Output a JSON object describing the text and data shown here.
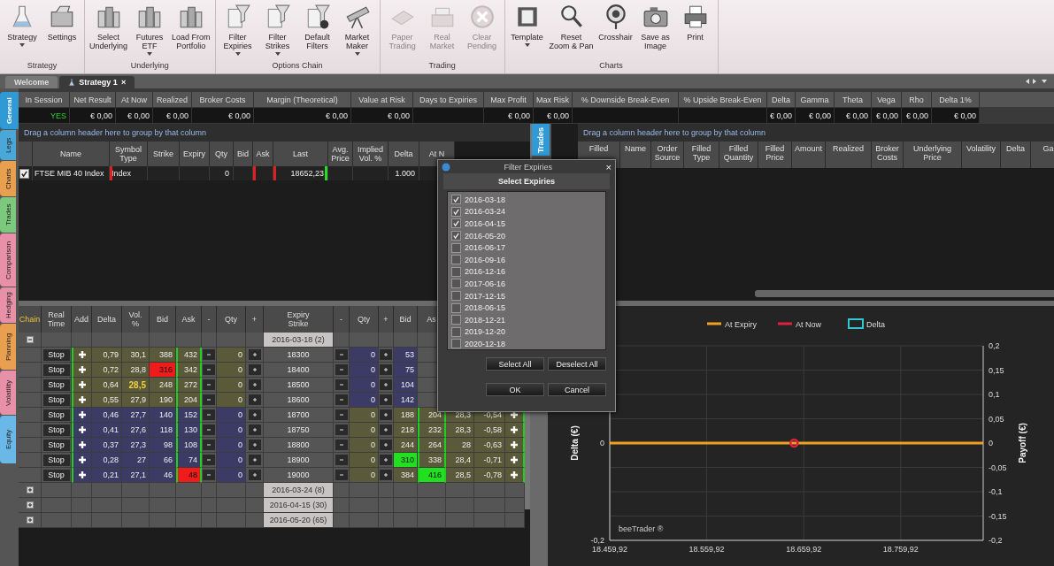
{
  "ribbon": {
    "groups": [
      {
        "label": "Strategy",
        "buttons": [
          {
            "label": "Strategy",
            "dropdown": true,
            "disabled": false
          },
          {
            "label": "Settings",
            "dropdown": false,
            "disabled": false
          }
        ]
      },
      {
        "label": "Underlying",
        "buttons": [
          {
            "label": "Select\nUnderlying",
            "dropdown": false,
            "disabled": false
          },
          {
            "label": "Futures\nETF",
            "dropdown": true,
            "disabled": false
          },
          {
            "label": "Load From\nPortfolio",
            "dropdown": false,
            "disabled": false
          }
        ]
      },
      {
        "label": "Options Chain",
        "buttons": [
          {
            "label": "Filter\nExpiries",
            "dropdown": true,
            "disabled": false
          },
          {
            "label": "Filter\nStrikes",
            "dropdown": true,
            "disabled": false
          },
          {
            "label": "Default\nFilters",
            "dropdown": false,
            "disabled": false
          },
          {
            "label": "Market\nMaker",
            "dropdown": true,
            "disabled": false
          }
        ]
      },
      {
        "label": "Trading",
        "buttons": [
          {
            "label": "Paper\nTrading",
            "dropdown": false,
            "disabled": true
          },
          {
            "label": "Real\nMarket",
            "dropdown": false,
            "disabled": true
          },
          {
            "label": "Clear\nPending",
            "dropdown": false,
            "disabled": true
          }
        ]
      },
      {
        "label": "Charts",
        "buttons": [
          {
            "label": "Template",
            "dropdown": true,
            "disabled": false
          },
          {
            "label": "Reset\nZoom & Pan",
            "dropdown": false,
            "disabled": false
          },
          {
            "label": "Crosshair",
            "dropdown": false,
            "disabled": false
          },
          {
            "label": "Save as\nImage",
            "dropdown": false,
            "disabled": false
          },
          {
            "label": "Print",
            "dropdown": false,
            "disabled": false
          }
        ]
      }
    ]
  },
  "doc_tabs": [
    {
      "label": "Welcome",
      "selected": false
    },
    {
      "label": "Strategy 1",
      "selected": true,
      "close": "×"
    }
  ],
  "side_tabs": [
    {
      "label": "General",
      "selected": true,
      "color": "#2f9ad6"
    },
    {
      "label": "Legs",
      "selected": false,
      "color": "#4aa8d8"
    },
    {
      "label": "Charts",
      "selected": false,
      "color": "#e8a050"
    },
    {
      "label": "Trades",
      "selected": false,
      "color": "#7cc87c"
    },
    {
      "label": "Comparison",
      "selected": false,
      "color": "#e890a8"
    },
    {
      "label": "Hedging",
      "selected": false,
      "color": "#e890a8"
    },
    {
      "label": "Planning",
      "selected": false,
      "color": "#e8a050"
    },
    {
      "label": "Volatility",
      "selected": false,
      "color": "#e890a8"
    },
    {
      "label": "Equity",
      "selected": false,
      "color": "#6ab8e8"
    }
  ],
  "summary": [
    {
      "label": "In Session",
      "value": "YES",
      "kind": "status"
    },
    {
      "label": "Net Result",
      "value": "€ 0,00"
    },
    {
      "label": "At Now",
      "value": "€ 0,00"
    },
    {
      "label": "Realized",
      "value": "€ 0,00"
    },
    {
      "label": "Broker Costs",
      "value": "€ 0,00"
    },
    {
      "label": "Margin (Theoretical)",
      "value": "€ 0,00"
    },
    {
      "label": "Value at Risk",
      "value": "€ 0,00"
    },
    {
      "label": "Days to Expiries"
    },
    {
      "label": "Max Profit",
      "value": "€ 0,00"
    },
    {
      "label": "Max Risk",
      "value": "€ 0,00"
    },
    {
      "label": "% Downside Break-Even"
    },
    {
      "label": "% Upside Break-Even"
    },
    {
      "label": "Delta",
      "value": "€ 0,00"
    },
    {
      "label": "Gamma",
      "value": "€ 0,00"
    },
    {
      "label": "Theta",
      "value": "€ 0,00"
    },
    {
      "label": "Vega",
      "value": "€ 0,00"
    },
    {
      "label": "Rho",
      "value": "€ 0,00"
    },
    {
      "label": "Delta 1%",
      "value": "€ 0,00"
    }
  ],
  "legs": {
    "group_hint": "Drag a column header here to group by that column",
    "columns": [
      "Name",
      "Symbol\nType",
      "Strike",
      "Expiry",
      "Qty",
      "Bid",
      "Ask",
      "Last",
      "Avg.\nPrice",
      "Implied\nVol. %",
      "Delta",
      "At N"
    ],
    "rows": [
      {
        "checked": true,
        "cells": [
          {
            "text": "FTSE MIB 40 Index"
          },
          {
            "text": "Index",
            "markers": [
              {
                "kind": "left",
                "color": "#e02020"
              }
            ]
          },
          {},
          {},
          {
            "text": "0"
          },
          {},
          {
            "markers": [
              {
                "kind": "left",
                "color": "#e02020"
              }
            ]
          },
          {
            "text": "18652,23",
            "markers": [
              {
                "kind": "left",
                "color": "#e02020"
              },
              {
                "kind": "right",
                "color": "#20e020"
              }
            ]
          },
          {},
          {},
          {
            "text": "1.000"
          },
          {}
        ]
      }
    ]
  },
  "trades": {
    "tab": "Trades",
    "group_hint": "Drag a column header here to group by that column",
    "columns": [
      "Filled",
      "Name",
      "Order\nSource",
      "Filled\nType",
      "Filled\nQuantity",
      "Filled\nPrice",
      "Amount",
      "Realized",
      "Broker\nCosts",
      "Underlying\nPrice",
      "Volatility",
      "Delta",
      "Ga"
    ]
  },
  "chain": {
    "columns": [
      "Chain",
      "Real\nTime",
      "Add",
      "Delta",
      "Vol.\n%",
      "Bid",
      "Ask",
      "-",
      "Qty",
      "+",
      "Expiry\nStrike",
      "-",
      "Qty",
      "+",
      "Bid",
      "As"
    ],
    "groups": [
      {
        "label": "2016-03-18 (2)",
        "expanded": true,
        "rows": [
          {
            "realtime": "Stop",
            "strike": "18300",
            "call": {
              "itm": true,
              "delta": "0,79",
              "vol": "30,1",
              "bid": "388",
              "ask": "432",
              "qty": "0"
            },
            "put": {
              "itm": false,
              "qty": "0",
              "bid": "53"
            }
          },
          {
            "realtime": "Stop",
            "strike": "18400",
            "call": {
              "itm": true,
              "delta": "0,72",
              "vol": "28,8",
              "bid": {
                "text": "316",
                "kind": "fill",
                "color": "#f01c1c"
              },
              "ask": "342",
              "qty": "0"
            },
            "put": {
              "itm": false,
              "qty": "0",
              "bid": "75"
            }
          },
          {
            "realtime": "Stop",
            "strike": "18500",
            "call": {
              "itm": true,
              "delta": "0,64",
              "vol": {
                "text": "28,5",
                "kind": "text",
                "color": "#f0d040"
              },
              "bid": "248",
              "ask": "272",
              "qty": "0"
            },
            "put": {
              "itm": false,
              "qty": "0",
              "bid": "104"
            }
          },
          {
            "realtime": "Stop",
            "strike": "18600",
            "call": {
              "itm": true,
              "delta": "0,55",
              "vol": "27,9",
              "bid": "190",
              "ask": "204",
              "qty": "0"
            },
            "put": {
              "itm": false,
              "qty": "0",
              "bid": "142"
            }
          },
          {
            "realtime": "Stop",
            "strike": "18700",
            "call": {
              "itm": false,
              "delta": "0,46",
              "vol": "27,7",
              "bid": "140",
              "ask": "152",
              "qty": "0"
            },
            "put": {
              "itm": true,
              "qty": "0",
              "bid": "188",
              "ask": "204",
              "vol": "28,3",
              "delta": "-0,54"
            }
          },
          {
            "realtime": "Stop",
            "strike": "18750",
            "call": {
              "itm": false,
              "delta": "0,41",
              "vol": "27,6",
              "bid": "118",
              "ask": "130",
              "qty": "0"
            },
            "put": {
              "itm": true,
              "qty": "0",
              "bid": "218",
              "ask": "232",
              "vol": "28,3",
              "delta": "-0,58"
            }
          },
          {
            "realtime": "Stop",
            "strike": "18800",
            "call": {
              "itm": false,
              "delta": "0,37",
              "vol": "27,3",
              "bid": "98",
              "ask": "108",
              "qty": "0"
            },
            "put": {
              "itm": true,
              "qty": "0",
              "bid": "244",
              "ask": "264",
              "vol": "28",
              "delta": "-0,63"
            }
          },
          {
            "realtime": "Stop",
            "strike": "18900",
            "call": {
              "itm": false,
              "delta": "0,28",
              "vol": "27",
              "bid": "66",
              "ask": "74",
              "qty": "0"
            },
            "put": {
              "itm": true,
              "qty": "0",
              "bid": {
                "text": "310",
                "kind": "fill",
                "color": "#20e020"
              },
              "ask": "338",
              "vol": "28,4",
              "delta": "-0,71"
            }
          },
          {
            "realtime": "Stop",
            "strike": "19000",
            "call": {
              "itm": false,
              "delta": "0,21",
              "vol": "27,1",
              "bid": "46",
              "ask": {
                "text": "48",
                "kind": "fill",
                "color": "#f01c1c"
              },
              "qty": "0"
            },
            "put": {
              "itm": true,
              "qty": "0",
              "bid": "384",
              "ask": {
                "text": "416",
                "kind": "fill",
                "color": "#20e020"
              },
              "vol": "28,5",
              "delta": "-0,78"
            }
          }
        ]
      },
      {
        "label": "2016-03-24 (8)",
        "expanded": false
      },
      {
        "label": "2016-04-15 (30)",
        "expanded": false
      },
      {
        "label": "2016-05-20 (65)",
        "expanded": false
      }
    ]
  },
  "chart": {
    "watermark": "beeTrader ®",
    "left_axis": {
      "label": "Delta (€)",
      "ticks": [
        "0",
        "-0,2"
      ]
    },
    "chart_data": {
      "type": "line",
      "ylabel": "Payoff (€)",
      "grid": true,
      "legend": true,
      "x": [
        18459.92,
        18650,
        18845
      ],
      "xlim": [
        18459.92,
        18845
      ],
      "ylim": [
        -0.2,
        0.2
      ],
      "xticks": [
        {
          "value": 18459.92,
          "label": "18.459,92"
        },
        {
          "value": 18559.92,
          "label": "18.559,92"
        },
        {
          "value": 18659.92,
          "label": "18.659,92"
        },
        {
          "value": 18759.92,
          "label": "18.759,92"
        }
      ],
      "yticks": [
        {
          "value": 0.2,
          "label": "0,2"
        },
        {
          "value": 0.15,
          "label": "0,15"
        },
        {
          "value": 0.1,
          "label": "0,1"
        },
        {
          "value": 0.05,
          "label": "0,05"
        },
        {
          "value": 0,
          "label": "0"
        },
        {
          "value": -0.05,
          "label": "-0,05"
        },
        {
          "value": -0.1,
          "label": "-0,1"
        },
        {
          "value": -0.15,
          "label": "-0,15"
        },
        {
          "value": -0.2,
          "label": "-0,2"
        }
      ],
      "series": [
        {
          "name": "At Expiry",
          "color": "#f0a020",
          "values": [
            0,
            0,
            0
          ]
        },
        {
          "name": "At Now",
          "color": "#e02040",
          "marker": "circle",
          "values": [
            null,
            0,
            null
          ]
        },
        {
          "name": "Delta",
          "color": "#30c8d0",
          "type": "area",
          "values": [
            null,
            null,
            null
          ]
        }
      ]
    }
  },
  "dialog": {
    "title": "Filter Expiries",
    "heading": "Select Expiries",
    "close": "×",
    "expiries": [
      {
        "label": "2016-03-18",
        "checked": true
      },
      {
        "label": "2016-03-24",
        "checked": true
      },
      {
        "label": "2016-04-15",
        "checked": true
      },
      {
        "label": "2016-05-20",
        "checked": true
      },
      {
        "label": "2016-06-17",
        "checked": false
      },
      {
        "label": "2016-09-16",
        "checked": false
      },
      {
        "label": "2016-12-16",
        "checked": false
      },
      {
        "label": "2017-06-16",
        "checked": false
      },
      {
        "label": "2017-12-15",
        "checked": false
      },
      {
        "label": "2018-06-15",
        "checked": false
      },
      {
        "label": "2018-12-21",
        "checked": false
      },
      {
        "label": "2019-12-20",
        "checked": false
      },
      {
        "label": "2020-12-18",
        "checked": false
      }
    ],
    "buttons": [
      "Select All",
      "Deselect All",
      "OK",
      "Cancel"
    ]
  }
}
